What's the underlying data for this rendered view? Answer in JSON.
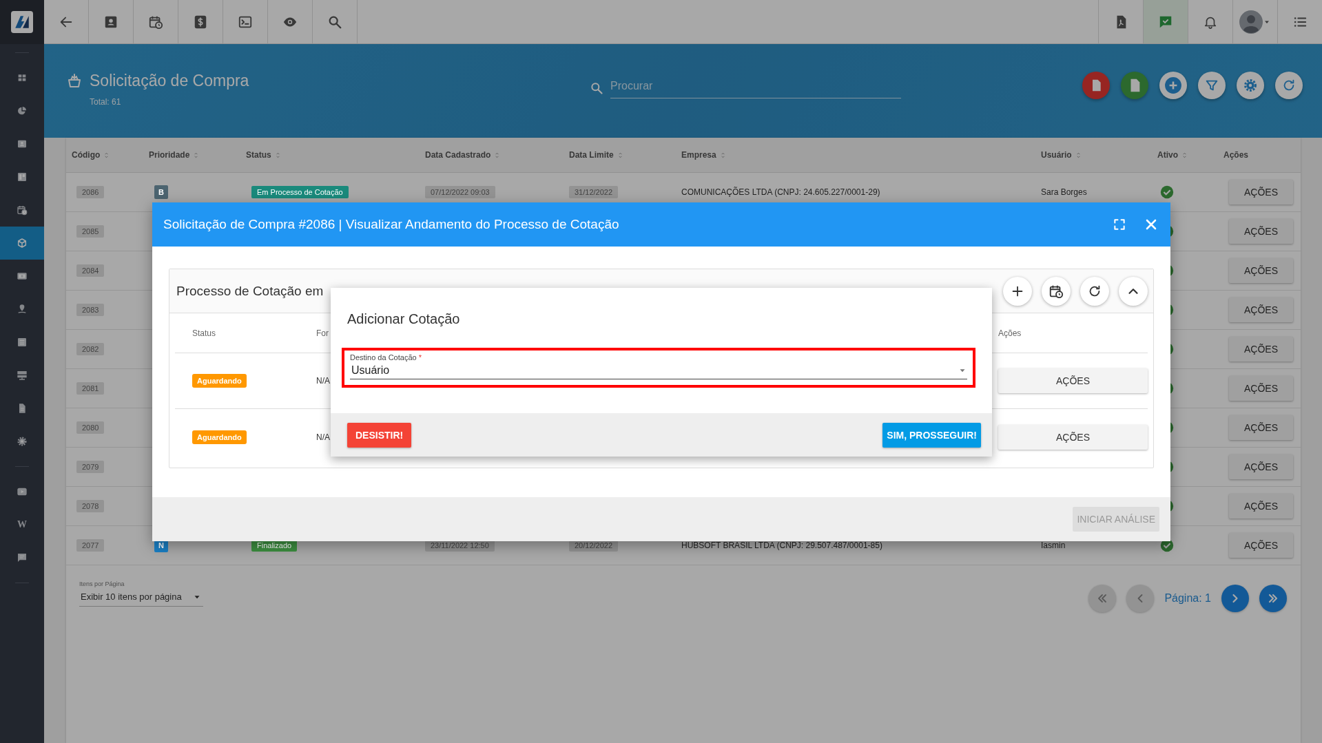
{
  "sidebar": {
    "items": [
      {
        "selected": false
      },
      {
        "selected": false
      },
      {
        "selected": false
      },
      {
        "selected": false
      },
      {
        "selected": false
      },
      {
        "selected": true
      },
      {
        "selected": false
      },
      {
        "selected": false
      },
      {
        "selected": false
      },
      {
        "selected": false
      },
      {
        "selected": false
      },
      {
        "selected": false
      },
      {
        "selected": false
      },
      {
        "selected": false,
        "label": "W"
      },
      {
        "selected": false
      }
    ]
  },
  "header": {
    "title": "Solicitação de Compra",
    "total": "Total: 61",
    "search": {
      "placeholder": "Procurar"
    }
  },
  "table": {
    "columns": [
      {
        "label": "Código",
        "sortable": true
      },
      {
        "label": "Prioridade",
        "sortable": true
      },
      {
        "label": "Status",
        "sortable": true
      },
      {
        "label": "Data Cadastrado",
        "sortable": true
      },
      {
        "label": "Data Limite",
        "sortable": true
      },
      {
        "label": "Empresa",
        "sortable": true
      },
      {
        "label": "Usuário",
        "sortable": true
      },
      {
        "label": "Ativo",
        "sortable": true
      },
      {
        "label": "Ações",
        "sortable": false
      }
    ],
    "rows": [
      {
        "codigo": "2086",
        "prioridade": {
          "label": "B",
          "color": "#4c6470"
        },
        "status": {
          "label": "Em Processo de Cotação",
          "color": "#1a8a7c"
        },
        "data_cadastrado": "07/12/2022 09:03",
        "data_limite": "31/12/2022",
        "empresa": "COMUNICAÇÕES LTDA (CNPJ: 24.605.227/0001-29)",
        "usuario": "Sara Borges",
        "ativo": true,
        "acoes": "AÇÕES"
      },
      {
        "codigo": "2085",
        "ativo": true,
        "acoes": "AÇÕES"
      },
      {
        "codigo": "2084",
        "ativo": true,
        "acoes": "AÇÕES"
      },
      {
        "codigo": "2083",
        "ativo": true,
        "acoes": "AÇÕES"
      },
      {
        "codigo": "2082",
        "ativo": true,
        "acoes": "AÇÕES"
      },
      {
        "codigo": "2081",
        "ativo": true,
        "acoes": "AÇÕES"
      },
      {
        "codigo": "2080",
        "ativo": true,
        "acoes": "AÇÕES"
      },
      {
        "codigo": "2079",
        "ativo": true,
        "acoes": "AÇÕES"
      },
      {
        "codigo": "2078",
        "ativo": true,
        "acoes": "AÇÕES"
      },
      {
        "codigo": "2077",
        "prioridade": {
          "label": "N",
          "color": "#1a7fc4"
        },
        "status": {
          "label": "Finalizado",
          "color": "#3d8f40"
        },
        "data_cadastrado": "23/11/2022 12:50",
        "data_limite": "20/12/2022",
        "empresa": "HUBSOFT BRASIL LTDA (CNPJ: 29.507.487/0001-85)",
        "usuario": "Iasmin",
        "ativo": true,
        "acoes": "AÇÕES"
      }
    ]
  },
  "pagination": {
    "page_size_label": "Itens por Página",
    "page_size": "Exibir 10 itens por página",
    "page": "Página: 1"
  },
  "modal": {
    "title": "Solicitação de Compra #2086 | Visualizar Andamento do Processo de Cotação",
    "card": {
      "title": "Processo de Cotação em",
      "columns": [
        "Status",
        "For",
        "Ações"
      ],
      "rows": [
        {
          "status": "Aguardando",
          "column_2": "N/A",
          "acoes": "AÇÕES"
        },
        {
          "status": "Aguardando",
          "column_2": "N/A",
          "acoes": "AÇÕES"
        }
      ]
    },
    "footer_button": {
      "label": "INICIAR ANÁLISE",
      "disabled": true
    }
  },
  "dialog": {
    "title": "Adicionar Cotação",
    "field": {
      "label": "Destino da Cotação",
      "required_mark": "*",
      "value": "Usuário",
      "highlighted": true
    },
    "cancel": "DESISTIR!",
    "confirm": "SIM, PROSSEGUIR!"
  }
}
